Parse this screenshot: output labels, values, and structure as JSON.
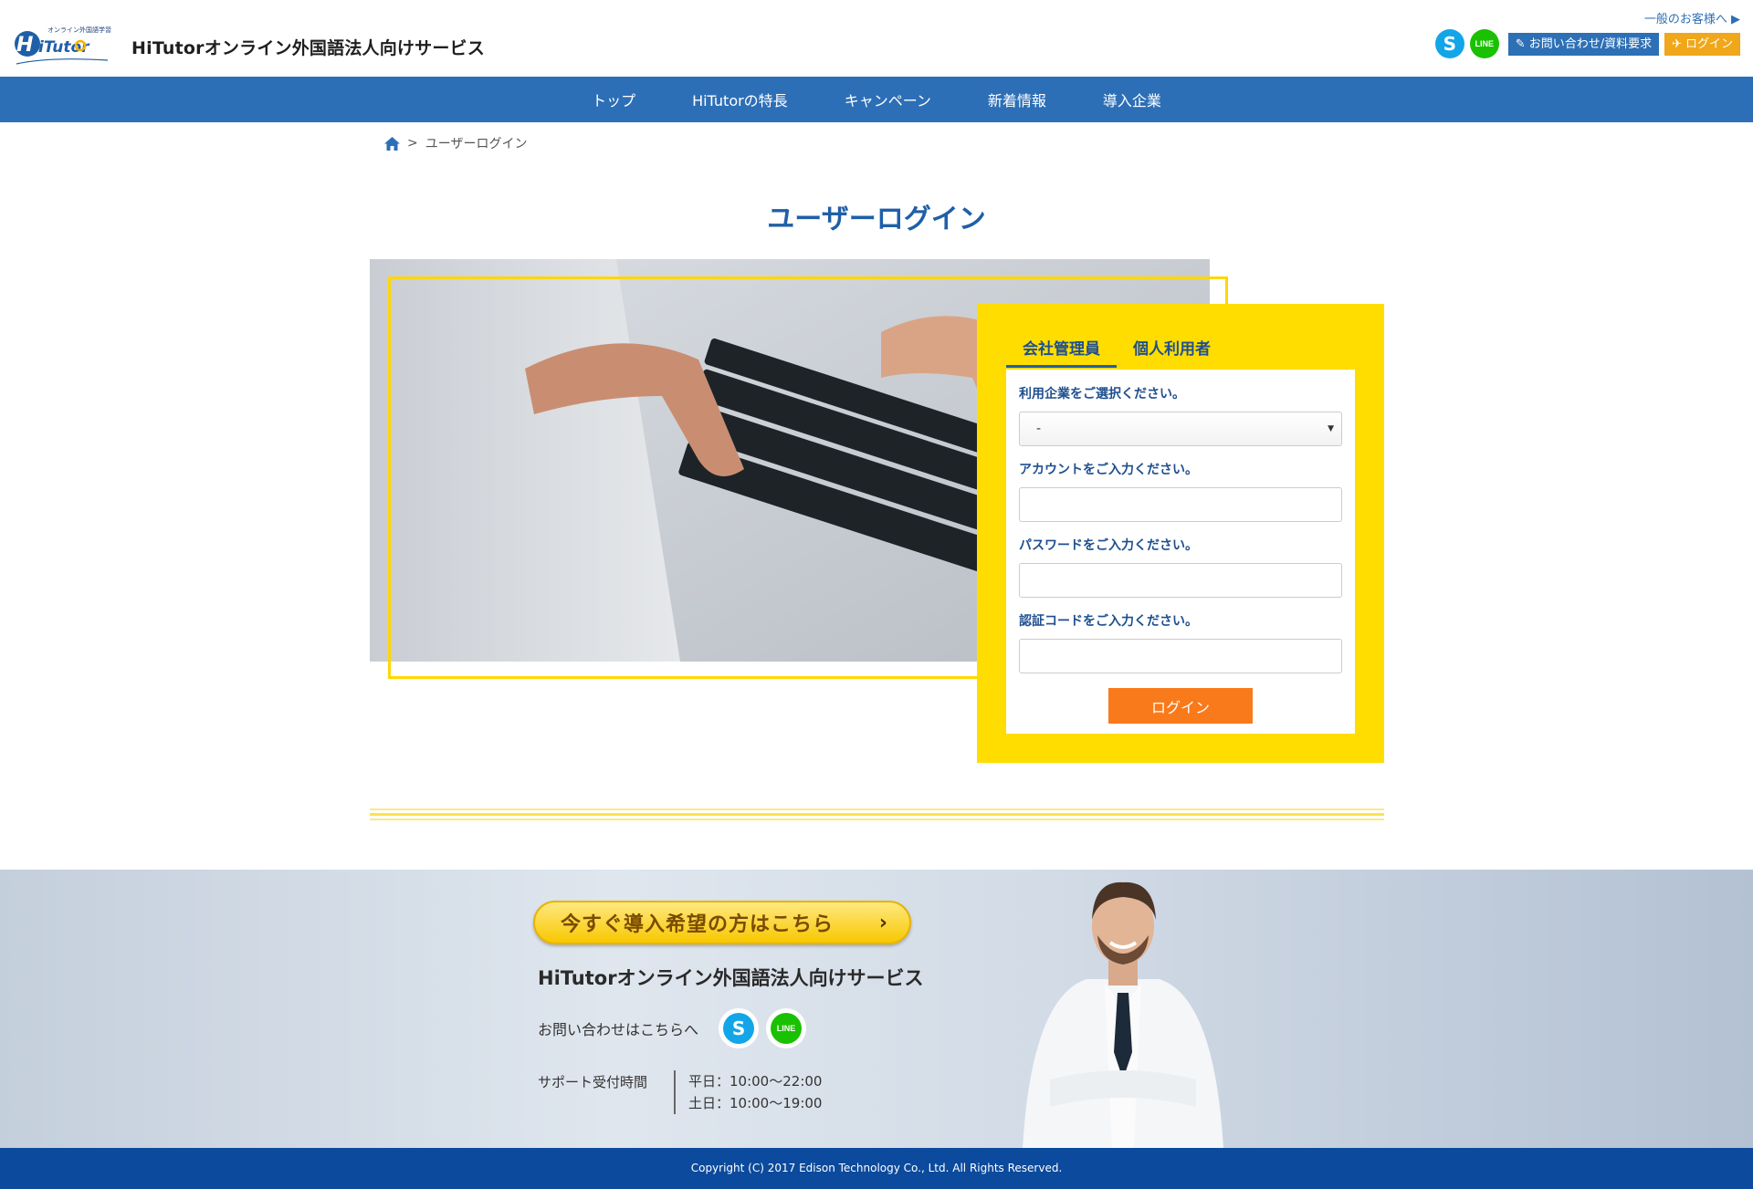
{
  "header": {
    "site_title": "HiTutorオンライン外国語法人向けサービス",
    "logo_tagline": "オンライン外国語学習",
    "logo_text": "HiTutor",
    "general_link": "一般のお客様へ ▶",
    "contact_button": "お問い合わせ/資料要求",
    "login_button": "ログイン",
    "line_label": "LINE"
  },
  "nav": {
    "items": [
      {
        "label": "トップ"
      },
      {
        "label": "HiTutorの特長"
      },
      {
        "label": "キャンペーン"
      },
      {
        "label": "新着情報"
      },
      {
        "label": "導入企業"
      }
    ]
  },
  "breadcrumb": {
    "separator": ">",
    "current": "ユーザーログイン"
  },
  "page": {
    "title": "ユーザーログイン"
  },
  "login": {
    "tabs": [
      {
        "label": "会社管理員",
        "active": true
      },
      {
        "label": "個人利用者",
        "active": false
      }
    ],
    "company_label": "利用企業をご選択ください。",
    "company_selected": "-",
    "account_label": "アカウントをご入力ください。",
    "account_value": "",
    "password_label": "パスワードをご入力ください。",
    "password_value": "",
    "code_label": "認証コードをご入力ください。",
    "code_value": "",
    "submit_label": "ログイン"
  },
  "banner": {
    "cta_label": "今すぐ導入希望の方はこちら",
    "title": "HiTutorオンライン外国語法人向けサービス",
    "contact_text": "お問い合わせはこちらへ",
    "support_label": "サポート受付時間",
    "hours_weekday": "平日：10:00〜22:00",
    "hours_weekend": "土日：10:00〜19:00"
  },
  "footer": {
    "copyright": "Copyright (C) 2017 Edison Technology Co., Ltd. All Rights Reserved."
  },
  "colors": {
    "primary_blue": "#2d6fb7",
    "accent_yellow": "#ffdd00",
    "login_orange": "#f97a1a",
    "footer_blue": "#0b4a9c"
  }
}
